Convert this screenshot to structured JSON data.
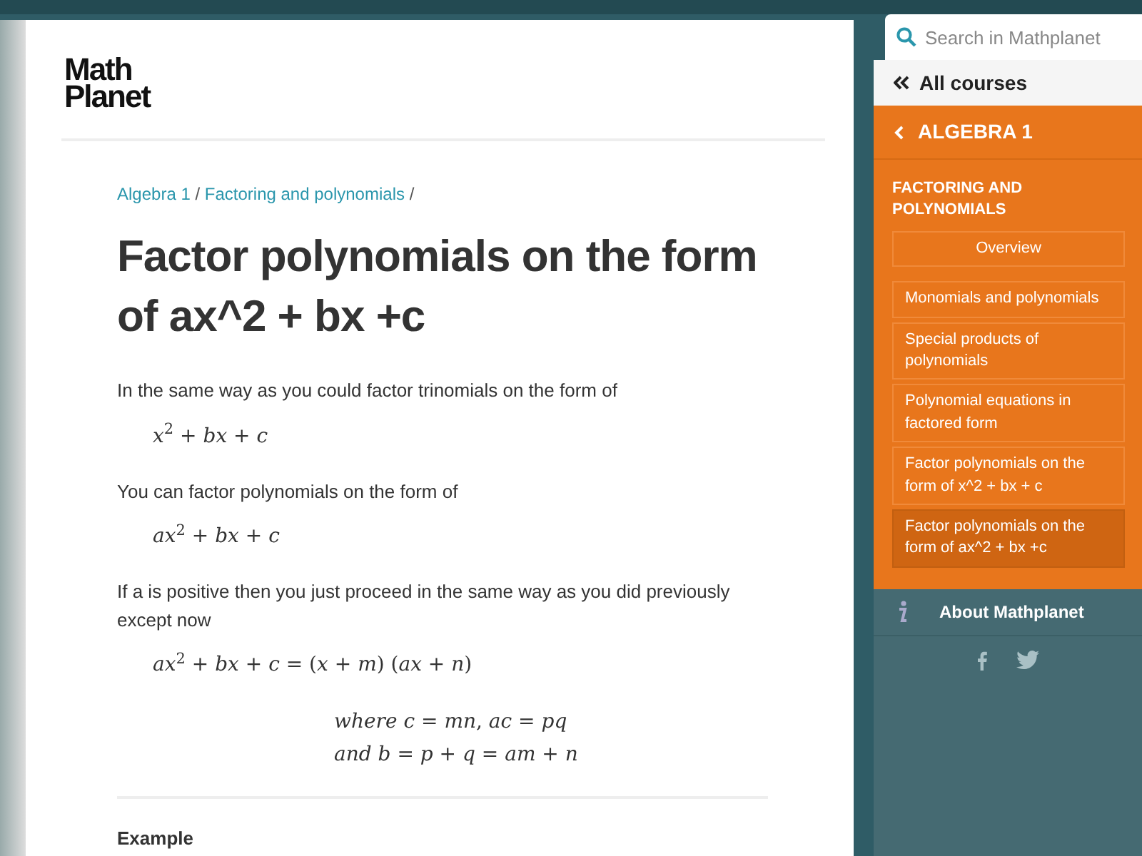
{
  "logo": {
    "line_1": "Math",
    "line_2": "Planet"
  },
  "breadcrumb": [
    {
      "label": "Algebra 1",
      "separator": "/"
    },
    {
      "label": "Factoring and polynomials",
      "separator": "/"
    }
  ],
  "title": "Factor polynomials on the form of ax^2 + bx +c",
  "content": [
    {
      "kind": "text",
      "text": "In the same way as you could factor trinomials on the form of"
    },
    {
      "kind": "formula",
      "lines": [
        "*x*$^{2}$ + *bx* + *c*"
      ]
    },
    {
      "kind": "text",
      "text": "You can factor polynomials on the form of"
    },
    {
      "kind": "formula",
      "lines": [
        "*ax*$^{2}$ + *bx* + *c*"
      ]
    },
    {
      "kind": "text",
      "text": "If a is positive then you just proceed in the same way as you did previously except now"
    },
    {
      "kind": "formula",
      "lines": [
        "*ax*$^{2}$ + *bx* + *c* = (*x* + *m*) (*ax* + *n*)"
      ]
    },
    {
      "kind": "centered_formula",
      "lines": [
        "*where  c* = *mn*,  *ac* = *pq*",
        "*and  b* = *p* + *q* = *am* + *n*"
      ]
    },
    {
      "kind": "rule"
    },
    {
      "kind": "heading",
      "text": "Example"
    }
  ],
  "sidebar": {
    "search": {
      "placeholder": "Search in Mathplanet"
    },
    "all_courses": "All courses",
    "course": "ALGEBRA 1",
    "chapter": "FACTORING AND POLYNOMIALS",
    "overview": "Overview",
    "items": [
      {
        "label": "Monomials and polynomials",
        "selected": false
      },
      {
        "label": "Special products of polynomials",
        "selected": false
      },
      {
        "label": "Polynomial equations in factored form",
        "selected": false
      },
      {
        "label": "Factor polynomials on the form of x^2 + bx + c",
        "selected": false
      },
      {
        "label": "Factor polynomials on the form of ax^2 + bx +c",
        "selected": true
      }
    ],
    "about": "About Mathplanet"
  }
}
